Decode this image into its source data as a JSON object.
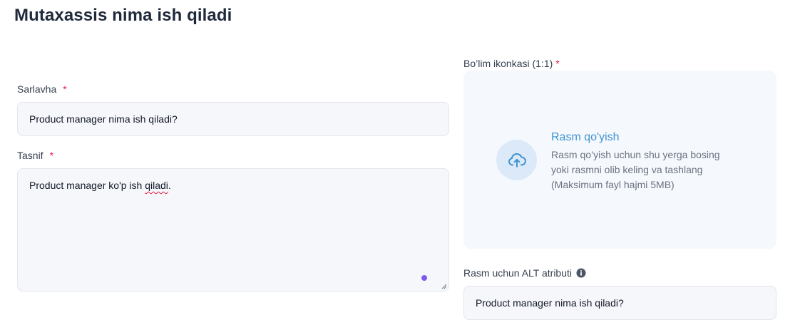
{
  "page": {
    "title": "Mutaxassis nima ish qiladi"
  },
  "form": {
    "heading_field": {
      "label": "Sarlavha",
      "required_mark": "*",
      "value": "Product manager nima ish qiladi?"
    },
    "description_field": {
      "label": "Tasnif",
      "required_mark": "*",
      "value_prefix": "Product manager ko'p ish ",
      "value_misspelled": "qiladi",
      "value_suffix": "."
    },
    "icon_upload": {
      "label": "Bo’lim ikonkasi (1:1)",
      "required_mark": "*",
      "icon": "cloud-upload-icon",
      "title": "Rasm qo'yish",
      "description_lines": [
        "Rasm qo’yish uchun shu yerga bosing",
        "yoki rasmni olib keling va tashlang",
        "(Maksimum fayl hajmi 5MB)"
      ]
    },
    "alt_field": {
      "label": "Rasm uchun ALT atributi",
      "info_icon": "info-icon",
      "value": "Product manager nima ish qiladi?"
    }
  },
  "colors": {
    "accent": "#3f93cf",
    "required": "#e11d48",
    "field_bg": "#f6f7fb",
    "upload_bg": "#f5f8fd",
    "grammarly": "#7c5cf0"
  }
}
